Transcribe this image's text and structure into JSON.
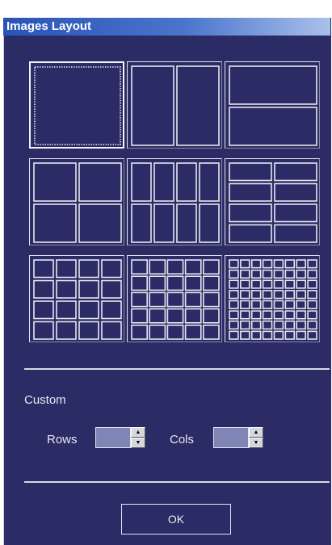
{
  "window": {
    "title": "Images Layout"
  },
  "layouts": [
    {
      "rows": 1,
      "cols": 1,
      "selected": true
    },
    {
      "rows": 1,
      "cols": 2
    },
    {
      "rows": 2,
      "cols": 1
    },
    {
      "rows": 2,
      "cols": 2
    },
    {
      "rows": 2,
      "cols": 4
    },
    {
      "rows": 4,
      "cols": 2
    },
    {
      "rows": 4,
      "cols": 4
    },
    {
      "rows": 5,
      "cols": 5
    },
    {
      "rows": 8,
      "cols": 8
    }
  ],
  "custom": {
    "label": "Custom",
    "rows_label": "Rows",
    "cols_label": "Cols",
    "rows_value": "",
    "cols_value": ""
  },
  "buttons": {
    "ok": "OK"
  },
  "colors": {
    "background": "#2b2b66",
    "line": "#e6e6ee",
    "field": "#7f86b6"
  },
  "icons": {
    "up": "▲",
    "down": "▼"
  }
}
